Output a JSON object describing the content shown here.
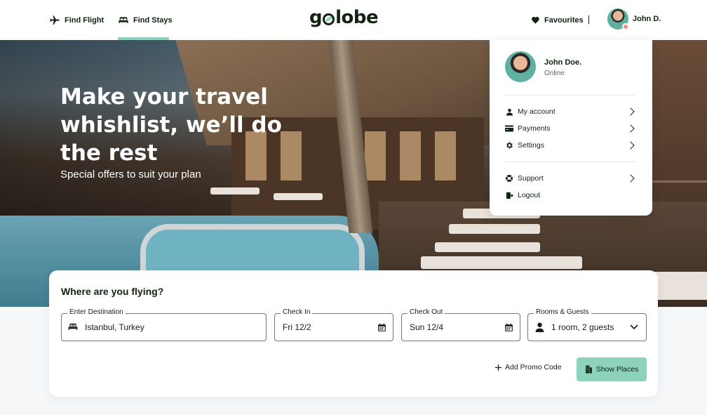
{
  "header": {
    "nav": [
      {
        "label": "Find Flight",
        "icon": "airplane-icon"
      },
      {
        "label": "Find Stays",
        "icon": "bed-icon",
        "active": true
      }
    ],
    "logo": {
      "before": "g",
      "after": "lobe"
    },
    "favourites_label": "Favourites",
    "divider": "|",
    "user_name": "John D."
  },
  "hero": {
    "title": "Make your travel whishlist, we’ll do the rest",
    "subtitle": "Special offers to suit your plan"
  },
  "dropdown": {
    "name": "John Doe.",
    "status": "Online",
    "items": [
      {
        "label": "My account",
        "icon": "user-icon"
      },
      {
        "label": "Payments",
        "icon": "card-icon"
      },
      {
        "label": "Settings",
        "icon": "gear-icon"
      },
      {
        "label": "Support",
        "icon": "support-icon"
      },
      {
        "label": "Logout",
        "icon": "logout-icon"
      }
    ]
  },
  "search": {
    "title": "Where are you flying?",
    "destination": {
      "label": "Enter Destination",
      "value": "Istanbul, Turkey"
    },
    "check_in": {
      "label": "Check In",
      "value": "Fri 12/2"
    },
    "check_out": {
      "label": "Check Out",
      "value": "Sun 12/4"
    },
    "rooms": {
      "label": "Rooms & Guests",
      "value": "1 room, 2 guests"
    },
    "promo_label": "Add Promo Code",
    "show_button": "Show Places"
  },
  "colors": {
    "accent": "#8dd3bb",
    "text": "#112211"
  }
}
